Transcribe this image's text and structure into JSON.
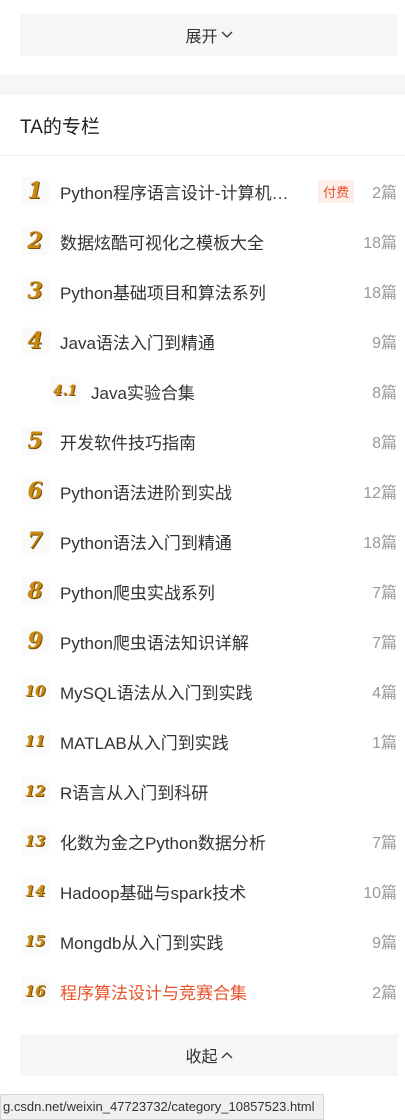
{
  "expand_label": "展开",
  "section_title": "TA的专栏",
  "columns": [
    {
      "badge": "1",
      "name": "Python程序语言设计-计算机…",
      "paid": "付费",
      "count": "2篇"
    },
    {
      "badge": "2",
      "name": "数据炫酷可视化之模板大全",
      "count": "18篇"
    },
    {
      "badge": "3",
      "name": "Python基础项目和算法系列",
      "count": "18篇"
    },
    {
      "badge": "4",
      "name": "Java语法入门到精通",
      "count": "9篇"
    },
    {
      "badge": "4.1",
      "name": "Java实验合集",
      "count": "8篇",
      "sub": true
    },
    {
      "badge": "5",
      "name": "开发软件技巧指南",
      "count": "8篇"
    },
    {
      "badge": "6",
      "name": "Python语法进阶到实战",
      "count": "12篇"
    },
    {
      "badge": "7",
      "name": "Python语法入门到精通",
      "count": "18篇"
    },
    {
      "badge": "8",
      "name": "Python爬虫实战系列",
      "count": "7篇"
    },
    {
      "badge": "9",
      "name": "Python爬虫语法知识详解",
      "count": "7篇"
    },
    {
      "badge": "10",
      "name": "MySQL语法从入门到实践",
      "count": "4篇"
    },
    {
      "badge": "11",
      "name": "MATLAB从入门到实践",
      "count": "1篇"
    },
    {
      "badge": "12",
      "name": "R语言从入门到科研",
      "count": ""
    },
    {
      "badge": "13",
      "name": "化数为金之Python数据分析",
      "count": "7篇"
    },
    {
      "badge": "14",
      "name": "Hadoop基础与spark技术",
      "count": "10篇"
    },
    {
      "badge": "15",
      "name": "Mongdb从入门到实践",
      "count": "9篇"
    },
    {
      "badge": "16",
      "name": "程序算法设计与竞赛合集",
      "count": "2篇",
      "highlight": true
    }
  ],
  "collapse_label": "收起",
  "status_url": "g.csdn.net/weixin_47723732/category_10857523.html",
  "colors": {
    "accent": "#e8532b",
    "bar_bg": "#f5f6f7",
    "count_gray": "#999999"
  }
}
